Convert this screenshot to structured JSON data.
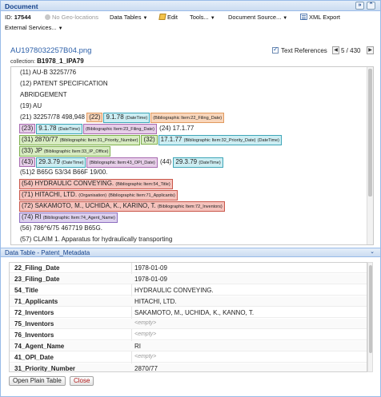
{
  "panel": {
    "title": "Document"
  },
  "toolbar": {
    "id_label": "ID:",
    "id_value": "17544",
    "geo": "No Geo-locations",
    "data_tables": "Data Tables",
    "edit": "Edit",
    "tools": "Tools...",
    "document_source": "Document Source...",
    "xml_export": "XML Export",
    "external_services": "External Services..."
  },
  "document": {
    "filename": "AU1978032257B04.png",
    "collection_label": "collection:",
    "collection_value": "B1978_1_IPA79",
    "text_references_label": "Text References",
    "text_references_checked": true,
    "page_info": "5 / 430"
  },
  "text": {
    "l1": "(11) AU-B 32257/76",
    "l2": "(12) PATENT SPECIFICATION",
    "l3": "ABRIDGEMENT",
    "l4": "(19) AU",
    "l5_a": "(21) 32257/78 498,948",
    "l5_b1": "(22)",
    "l5_b2": "9.1.78",
    "l5_b3": "(DateTime)",
    "l5_b4": "(Bibliographic Item:22_Filing_Date)",
    "l6_a": "(23)",
    "l6_b": "9.1.78",
    "l6_c": "(DateTime)",
    "l6_d": "(Bibliographic Item:23_Filing_Date)",
    "l6_e": "(24) 17.1.77",
    "l7_a": "(31) 2870/77",
    "l7_b": "(Bibliographic Item:31_Priority_Number)",
    "l7_c": "(32)",
    "l7_d": "17.1.77",
    "l7_e": "(Bibliographic Item:32_Priority_Date)",
    "l7_f": "(DateTime)",
    "l8_a": "(33) JP",
    "l8_b": "(Bibliographic Item:33_IP_Office)",
    "l9_a": "(43)",
    "l9_b": "29.3.79",
    "l9_c": "(DateTime)",
    "l9_d": "(Bibliographic Item:43_OPI_Date)",
    "l9_e": "(44)",
    "l9_f": "29.3.79",
    "l9_g": "(DateTime)",
    "l10": "(51)2 B65G 53/34 B66F 19/00.",
    "l11_a": "(54) HYDRAULIC CONVEYING.",
    "l11_b": "(Bibliographic Item:54_Title)",
    "l12_a": "(71) HITACHI, LTD.",
    "l12_b": "(Organisation)",
    "l12_c": "(Bibliographic Item:71_Applicants)",
    "l13_a": "(72) SAKAMOTO, M., UCHIDA, K., KARINO, T.",
    "l13_b": "(Bibliographic Item:72_Inventors)",
    "l14_a": "(74) RI",
    "l14_b": "(Bibliographic Item:74_Agent_Name)",
    "l15": "(56) 786^6/75 467719 B65G.",
    "l16": "(57) CLAIM 1. Apparatus for hydraulically transporting"
  },
  "data_table": {
    "title": "Data Table - Patent_Metadata",
    "rows": [
      {
        "key": "22_Filing_Date",
        "value": "1978-01-09"
      },
      {
        "key": "23_Filing_Date",
        "value": "1978-01-09"
      },
      {
        "key": "54_Title",
        "value": "HYDRAULIC CONVEYING."
      },
      {
        "key": "71_Applicants",
        "value": "HITACHI, LTD."
      },
      {
        "key": "72_Inventors",
        "value": "SAKAMOTO, M., UCHIDA, K., KANNO, T."
      },
      {
        "key": "75_Inventors",
        "value": "<empty>"
      },
      {
        "key": "76_Inventors",
        "value": "<empty>"
      },
      {
        "key": "74_Agent_Name",
        "value": "RI"
      },
      {
        "key": "41_OPI_Date",
        "value": "<empty>"
      },
      {
        "key": "31_Priority_Number",
        "value": "2870/77"
      }
    ]
  },
  "buttons": {
    "open_plain_table": "Open Plain Table",
    "close": "Close"
  },
  "colors": {
    "header_text": "#15428b",
    "link": "#2a5ea8",
    "orange": "#f9d6bb",
    "purple": "#e7cfe9",
    "cyan": "#cdeef3",
    "green": "#d8ecc2",
    "red": "#f5c3bd",
    "violet": "#dcd0ee"
  }
}
